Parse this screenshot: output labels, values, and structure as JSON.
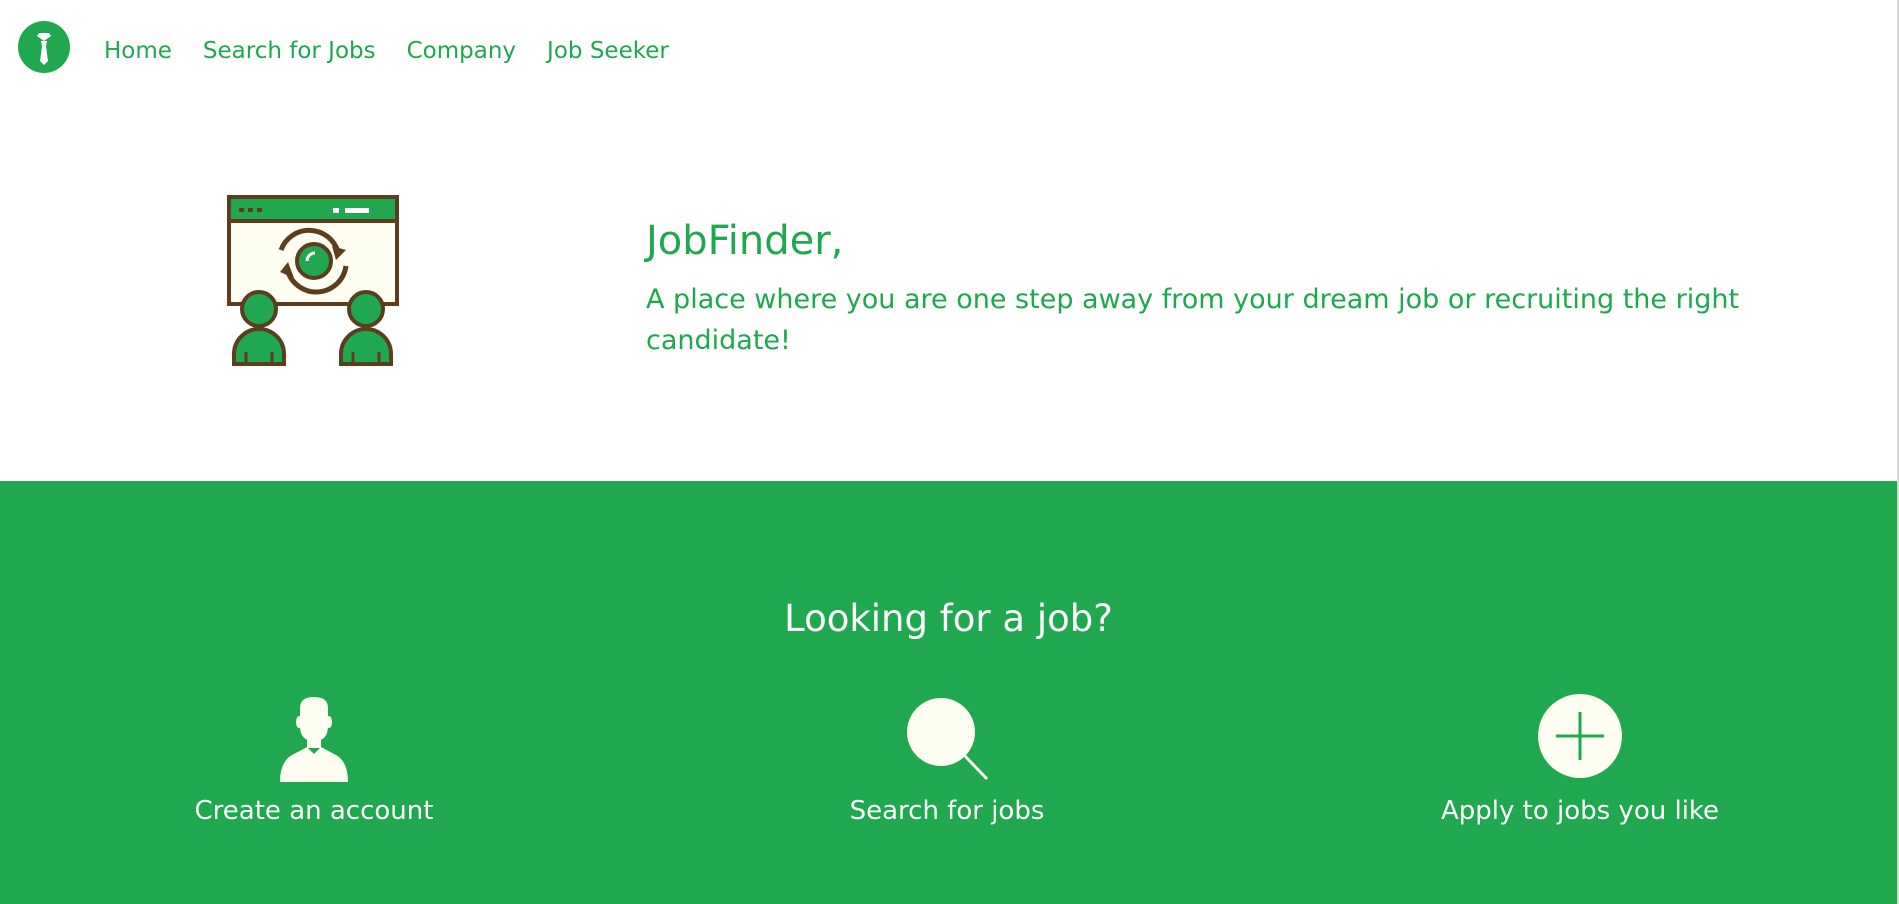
{
  "colors": {
    "brand_green": "#1fa84d",
    "cream": "#fdfdf2",
    "brown": "#5c3d1e",
    "white": "#ffffff"
  },
  "nav": {
    "logo_icon": "necktie-icon",
    "links": [
      {
        "label": "Home"
      },
      {
        "label": "Search for Jobs"
      },
      {
        "label": "Company"
      },
      {
        "label": "Job Seeker"
      }
    ]
  },
  "hero": {
    "illustration_icon": "recruitment-screen-icon",
    "title": "JobFinder,",
    "subtitle": "A place where you are one step away from your dream job or recruiting the right candidate!"
  },
  "steps_section": {
    "heading": "Looking for a job?",
    "steps": [
      {
        "icon": "user-icon",
        "label": "Create an account"
      },
      {
        "icon": "magnifier-icon",
        "label": "Search for jobs"
      },
      {
        "icon": "plus-circle-icon",
        "label": "Apply to jobs you like"
      }
    ]
  }
}
